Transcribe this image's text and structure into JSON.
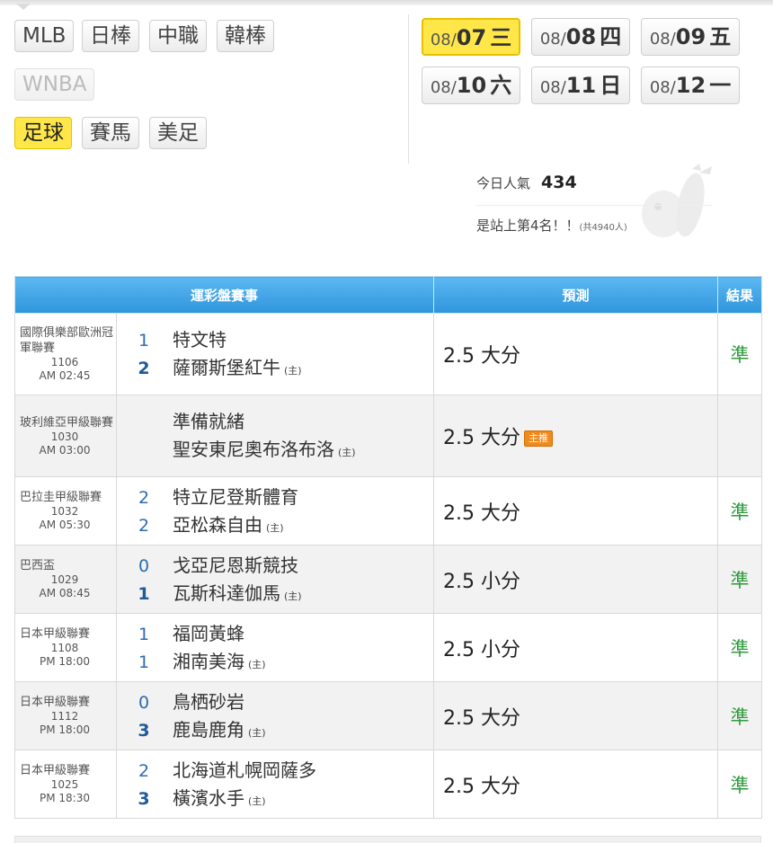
{
  "sports": {
    "mlb": "MLB",
    "npb": "日棒",
    "cpbl": "中職",
    "kbo": "韓棒",
    "wnba": "WNBA",
    "soccer": "足球",
    "horse": "賽馬",
    "nfl": "美足"
  },
  "dates": [
    {
      "mo": "08/",
      "dy": "07",
      "wd": "三"
    },
    {
      "mo": "08/",
      "dy": "08",
      "wd": "四"
    },
    {
      "mo": "08/",
      "dy": "09",
      "wd": "五"
    },
    {
      "mo": "08/",
      "dy": "10",
      "wd": "六"
    },
    {
      "mo": "08/",
      "dy": "11",
      "wd": "日"
    },
    {
      "mo": "08/",
      "dy": "12",
      "wd": "一"
    }
  ],
  "popularity": {
    "label": "今日人氣",
    "count": "434",
    "rank_text": "是站上第4名！！",
    "total_text": "(共4940人)"
  },
  "table": {
    "headers": [
      "運彩盤賽事",
      "預測",
      "結果"
    ],
    "home_mark": "(主)",
    "hot_badge": "主推",
    "rows": [
      {
        "league": "國際俱樂部歐洲冠軍聯賽",
        "code": "1106",
        "time": "AM 02:45",
        "away": "特文特",
        "away_score": "1",
        "home": "薩爾斯堡紅牛",
        "home_score": "2",
        "prediction": "2.5 大分",
        "result": "準"
      },
      {
        "league": "玻利維亞甲級聯賽",
        "code": "1030",
        "time": "AM 03:00",
        "away": "準備就緒",
        "away_score": "",
        "home": "聖安東尼奧布洛布洛",
        "home_score": "",
        "prediction": "2.5 大分",
        "result": ""
      },
      {
        "league": "巴拉圭甲級聯賽",
        "code": "1032",
        "time": "AM 05:30",
        "away": "特立尼登斯體育",
        "away_score": "2",
        "home": "亞松森自由",
        "home_score": "2",
        "prediction": "2.5 大分",
        "result": "準"
      },
      {
        "league": "巴西盃",
        "code": "1029",
        "time": "AM 08:45",
        "away": "戈亞尼恩斯競技",
        "away_score": "0",
        "home": "瓦斯科達伽馬",
        "home_score": "1",
        "prediction": "2.5 小分",
        "result": "準"
      },
      {
        "league": "日本甲級聯賽",
        "code": "1108",
        "time": "PM 18:00",
        "away": "福岡黃蜂",
        "away_score": "1",
        "home": "湘南美海",
        "home_score": "1",
        "prediction": "2.5 小分",
        "result": "準"
      },
      {
        "league": "日本甲級聯賽",
        "code": "1112",
        "time": "PM 18:00",
        "away": "鳥栖砂岩",
        "away_score": "0",
        "home": "鹿島鹿角",
        "home_score": "3",
        "prediction": "2.5 大分",
        "result": "準"
      },
      {
        "league": "日本甲級聯賽",
        "code": "1025",
        "time": "PM 18:30",
        "away": "北海道札幌岡薩多",
        "away_score": "2",
        "home": "橫濱水手",
        "home_score": "3",
        "prediction": "2.5 大分",
        "result": "準"
      }
    ]
  }
}
